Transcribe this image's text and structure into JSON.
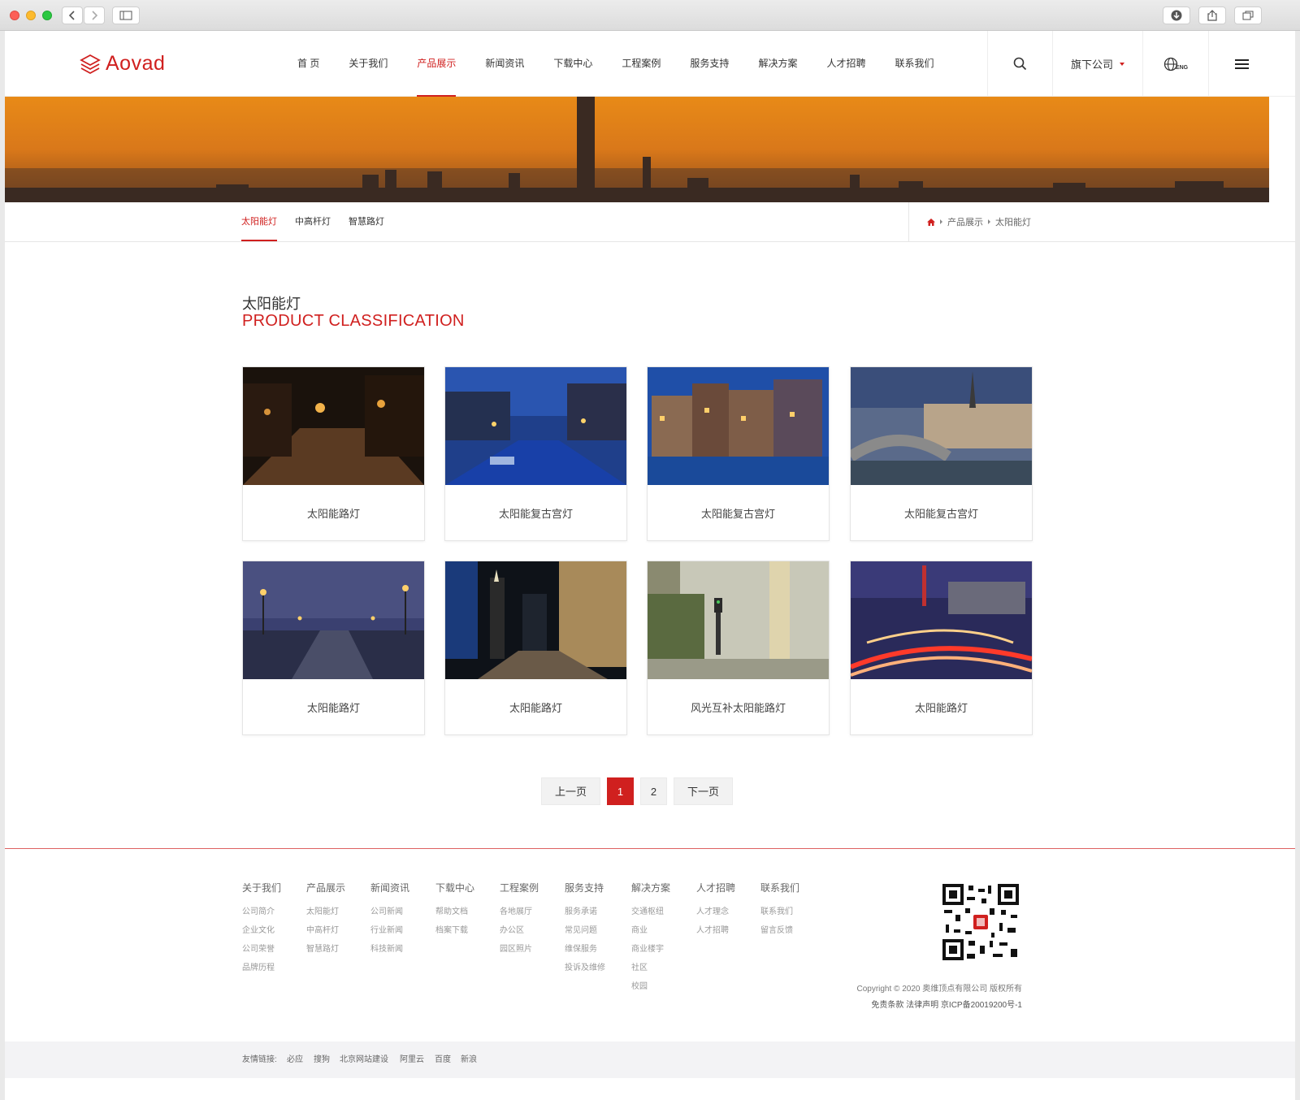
{
  "site": {
    "brand": "Aovad",
    "nav": [
      "首 页",
      "关于我们",
      "产品展示",
      "新闻资讯",
      "下载中心",
      "工程案例",
      "服务支持",
      "解决方案",
      "人才招聘",
      "联系我们"
    ],
    "active_nav_index": 2,
    "subsidiary_label": "旗下公司",
    "lang_label": "ENG"
  },
  "subnav": {
    "tabs": [
      "太阳能灯",
      "中高杆灯",
      "智慧路灯"
    ],
    "active_index": 0,
    "breadcrumb": [
      "产品展示",
      "太阳能灯"
    ]
  },
  "section": {
    "title": "太阳能灯",
    "subtitle": "PRODUCT CLASSIFICATION"
  },
  "products": [
    {
      "name": "太阳能路灯"
    },
    {
      "name": "太阳能复古宫灯"
    },
    {
      "name": "太阳能复古宫灯"
    },
    {
      "name": "太阳能复古宫灯"
    },
    {
      "name": "太阳能路灯"
    },
    {
      "name": "太阳能路灯"
    },
    {
      "name": "风光互补太阳能路灯"
    },
    {
      "name": "太阳能路灯"
    }
  ],
  "pagination": {
    "prev": "上一页",
    "pages": [
      "1",
      "2"
    ],
    "current": "1",
    "next": "下一页"
  },
  "footer": {
    "columns": [
      {
        "title": "关于我们",
        "links": [
          "公司简介",
          "企业文化",
          "公司荣誉",
          "品牌历程"
        ]
      },
      {
        "title": "产品展示",
        "links": [
          "太阳能灯",
          "中高杆灯",
          "智慧路灯"
        ]
      },
      {
        "title": "新闻资讯",
        "links": [
          "公司新闻",
          "行业新闻",
          "科技新闻"
        ]
      },
      {
        "title": "下载中心",
        "links": [
          "帮助文档",
          "档案下载"
        ]
      },
      {
        "title": "工程案例",
        "links": [
          "各地展厅",
          "办公区",
          "园区照片"
        ]
      },
      {
        "title": "服务支持",
        "links": [
          "服务承诺",
          "常见问题",
          "维保服务",
          "投诉及维修"
        ]
      },
      {
        "title": "解决方案",
        "links": [
          "交通枢纽",
          "商业",
          "商业楼宇",
          "社区",
          "校园"
        ]
      },
      {
        "title": "人才招聘",
        "links": [
          "人才理念",
          "人才招聘"
        ]
      },
      {
        "title": "联系我们",
        "links": [
          "联系我们",
          "留言反馈"
        ]
      }
    ],
    "copyright": "Copyright © 2020 奥维顶点有限公司 版权所有",
    "legal": "免责条款 法律声明 京ICP备20019200号-1",
    "friends_label": "友情链接:",
    "friends": [
      "必应",
      "搜狗",
      "北京网站建设",
      "阿里云",
      "百度",
      "新浪"
    ]
  },
  "colors": {
    "accent": "#d0201f"
  }
}
